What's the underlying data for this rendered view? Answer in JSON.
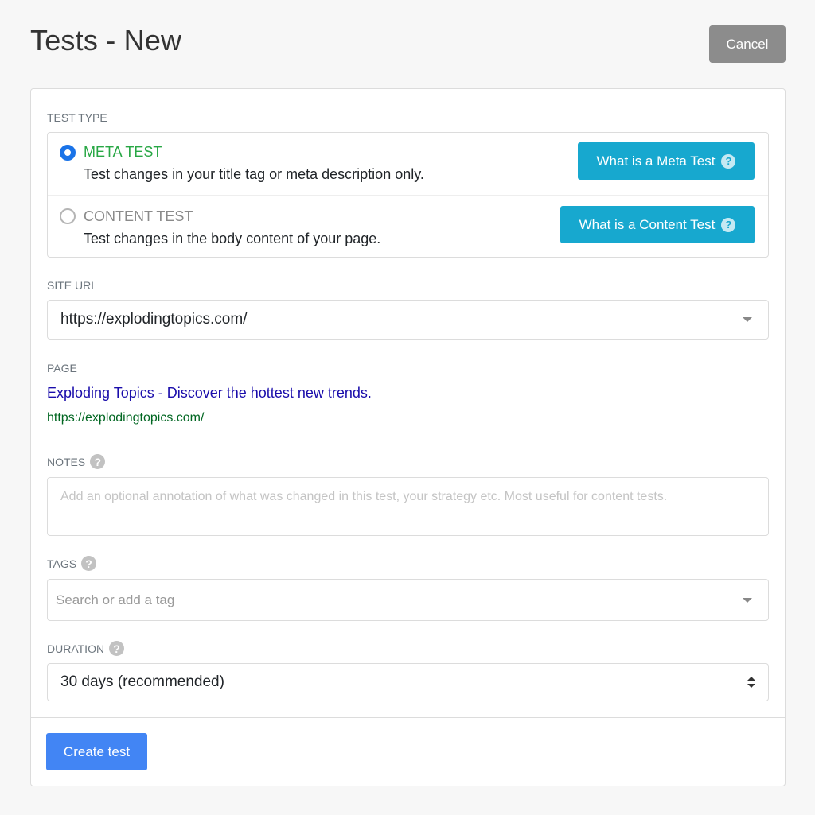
{
  "header": {
    "title": "Tests - New",
    "cancel_label": "Cancel"
  },
  "test_type": {
    "label": "TEST TYPE",
    "options": [
      {
        "name": "META TEST",
        "description": "Test changes in your title tag or meta description only.",
        "selected": true,
        "help_label": "What is a Meta Test"
      },
      {
        "name": "CONTENT TEST",
        "description": "Test changes in the body content of your page.",
        "selected": false,
        "help_label": "What is a Content Test"
      }
    ]
  },
  "site_url": {
    "label": "SITE URL",
    "value": "https://explodingtopics.com/"
  },
  "page": {
    "label": "PAGE",
    "title": "Exploding Topics - Discover the hottest new trends.",
    "url": "https://explodingtopics.com/"
  },
  "notes": {
    "label": "NOTES",
    "placeholder": "Add an optional annotation of what was changed in this test, your strategy etc. Most useful for content tests."
  },
  "tags": {
    "label": "TAGS",
    "placeholder": "Search or add a tag"
  },
  "duration": {
    "label": "DURATION",
    "value": "30 days (recommended)"
  },
  "footer": {
    "create_label": "Create test"
  },
  "colors": {
    "accent_info": "#17a8cf",
    "primary": "#4285f4",
    "selected_text": "#28a745",
    "link_title": "#1a0dab",
    "link_url": "#006621",
    "cancel_bg": "#8c8c8c"
  },
  "icons": {
    "help": "question-circle-icon",
    "dropdown": "caret-down-icon",
    "stepper": "up-down-arrows-icon"
  }
}
